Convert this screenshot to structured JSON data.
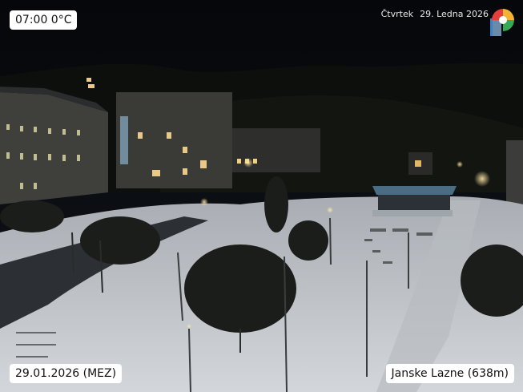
{
  "overlay": {
    "time_temp": "07:00  0°C",
    "weekday": "Čtvrtek",
    "date_long": "29. Ledna 2026",
    "date_stamp": "29.01.2026 (MEZ)",
    "location": "Janske Lazne (638m)"
  },
  "logo": {
    "icon": "webcam-brand-logo",
    "colors": [
      "#e2403a",
      "#f2b233",
      "#3aa757",
      "#3b82c4",
      "#8a8f98"
    ]
  },
  "scene": {
    "description_icon": "night-snowy-spa-town-webcam",
    "colors": {
      "sky": "#07090c",
      "snow": "#c9cdd2",
      "lamp": "#f6d68a",
      "building": "#4a4a45"
    }
  }
}
